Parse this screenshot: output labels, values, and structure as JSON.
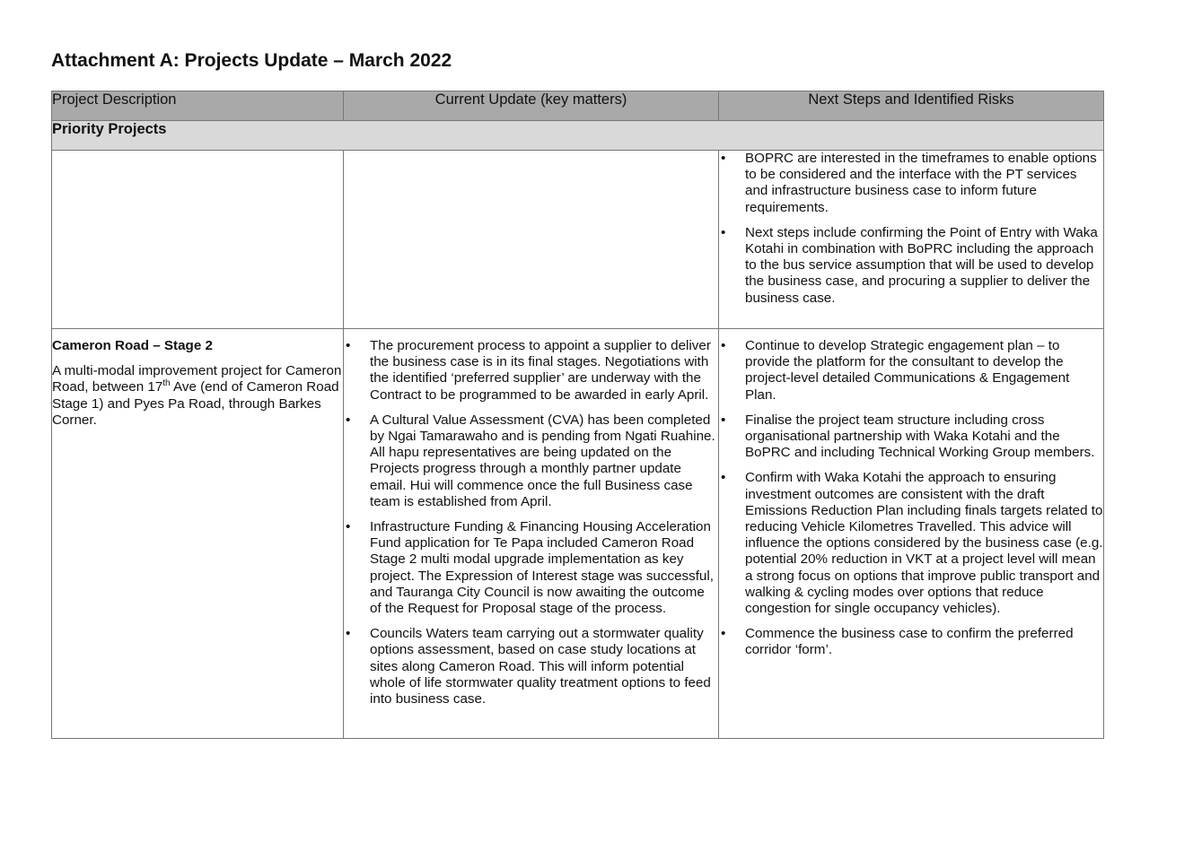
{
  "document": {
    "title": "Attachment A: Projects Update – March 2022"
  },
  "table": {
    "headers": [
      "Project Description",
      "Current Update (key matters)",
      "Next Steps and Identified Risks"
    ],
    "section": "Priority Projects",
    "continued_row": {
      "next_steps": [
        "BOPRC are interested in the timeframes to enable options to be considered and the interface with the PT services and infrastructure business case to inform future requirements.",
        "Next steps include confirming the Point of Entry with Waka Kotahi in combination with BoPRC including the approach to the bus service assumption that will be used to develop the business case, and procuring a supplier to deliver the business case."
      ]
    },
    "cameron_row": {
      "name": "Cameron Road – Stage 2",
      "description_before_sup": "A multi-modal improvement project for Cameron Road, between 17",
      "description_sup": "th",
      "description_after_sup": " Ave (end of Cameron Road Stage 1) and Pyes Pa Road, through Barkes Corner.",
      "updates": [
        "The procurement process to appoint a supplier to deliver the business case is in its final stages. Negotiations with the identified ‘preferred supplier’ are underway with the Contract to be programmed to be awarded in early April.",
        "A Cultural Value Assessment (CVA) has been completed by Ngai Tamarawaho and is pending from Ngati Ruahine. All hapu representatives are being updated on the Projects progress through a monthly partner update email. Hui will commence once the full Business case team is established from April.",
        "Infrastructure Funding & Financing Housing Acceleration Fund application for Te Papa included Cameron Road Stage 2 multi modal upgrade implementation as key project. The Expression of Interest stage was successful, and Tauranga City Council is now awaiting the outcome of the Request for Proposal stage of the process.",
        "Councils Waters team carrying out a stormwater quality options assessment, based on case study locations at sites along Cameron Road. This will inform potential whole of life stormwater quality treatment options to feed into business case."
      ],
      "next_steps": [
        "Continue to develop Strategic engagement plan – to provide the platform for the consultant to develop the project-level detailed Communications & Engagement Plan.",
        "Finalise the project team structure including cross organisational partnership with Waka Kotahi and the BoPRC and including Technical Working Group members.",
        "Confirm with Waka Kotahi the approach to ensuring investment outcomes are consistent with the draft Emissions Reduction Plan including finals targets related to reducing Vehicle Kilometres Travelled. This advice will influence the options considered by the business case (e.g. potential 20% reduction in VKT at a project level will mean a strong focus on options that improve public transport and walking & cycling modes over options that reduce congestion for single occupancy vehicles).",
        "Commence the business case to confirm the preferred corridor ‘form’."
      ]
    }
  }
}
